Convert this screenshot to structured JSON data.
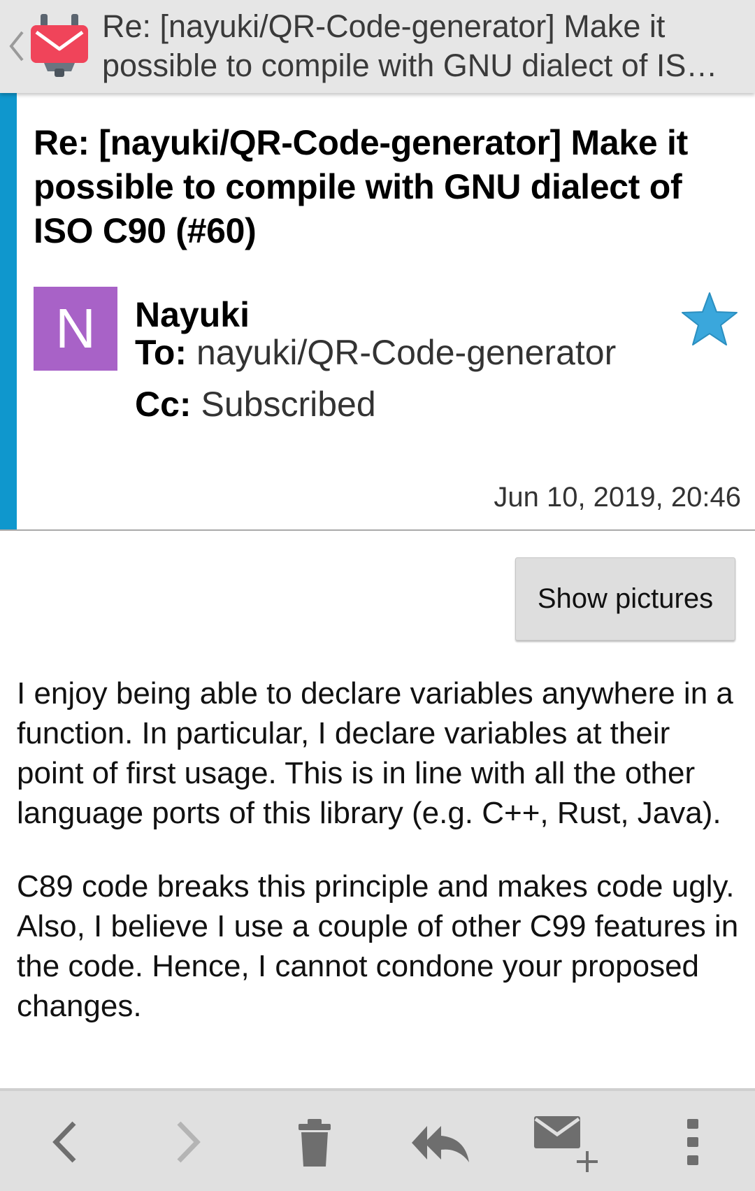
{
  "appbar": {
    "title_line1": "Re: [nayuki/QR-Code-generator] Make it",
    "title_line2": "possible to compile with GNU dialect of IS…",
    "logo_icon": "k9-mail-logo-icon",
    "back_icon": "chevron-left-icon"
  },
  "header": {
    "subject": "Re: [nayuki/QR-Code-generator] Make it possible to compile with GNU dialect of ISO C90 (#60)",
    "avatar_letter": "N",
    "sender": "Nayuki",
    "to_label": "To:",
    "to_value": "nayuki/QR-Code-generator",
    "cc_label": "Cc:",
    "cc_value": "Subscribed",
    "date": "Jun 10, 2019, 20:46",
    "starred": true
  },
  "body": {
    "show_pictures_label": "Show pictures",
    "paragraphs": [
      "I enjoy being able to declare variables anywhere in a function. In particular, I declare variables at their point of first usage. This is in line with all the other language ports of this library (e.g. C++, Rust, Java).",
      "C89 code breaks this principle and makes code ugly. Also, I believe I use a couple of other C99 features in the code. Hence, I cannot condone your proposed changes."
    ]
  },
  "toolbar": {
    "items": [
      {
        "icon": "previous-icon"
      },
      {
        "icon": "next-icon"
      },
      {
        "icon": "delete-icon"
      },
      {
        "icon": "reply-all-icon"
      },
      {
        "icon": "compose-icon"
      },
      {
        "icon": "overflow-menu-icon"
      }
    ]
  },
  "colors": {
    "account_stripe": "#0f97cd",
    "avatar_bg": "#a862c7",
    "star": "#3aa7dc",
    "logo_red": "#f0445a"
  }
}
